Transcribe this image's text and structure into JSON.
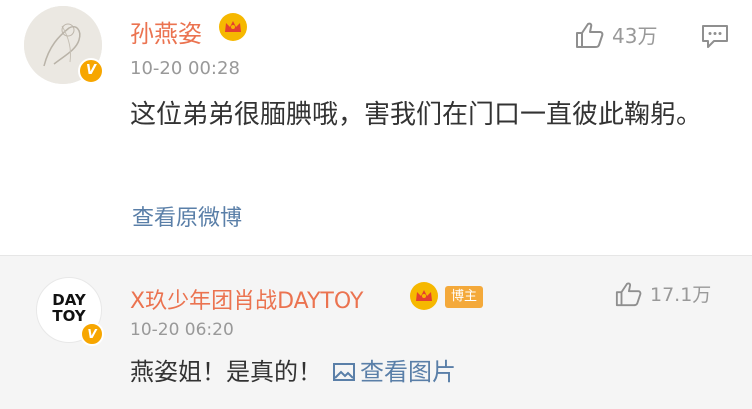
{
  "comments": [
    {
      "username": "孙燕姿",
      "time": "10-20 00:28",
      "text": "这位弟弟很腼腆哦，害我们在门口一直彼此鞠躬。",
      "likes": "43万",
      "view_original": "查看原微博",
      "verified_icon": "verified-v-icon",
      "crown_icon": "crown-icon"
    },
    {
      "username": "X玖少年团肖战DAYTOY",
      "badge": "博主",
      "time": "10-20 06:20",
      "text": "燕姿姐！是真的！",
      "view_pic": "查看图片",
      "likes": "17.1万",
      "avatar_text_line1": "DAY",
      "avatar_text_line2": "TOY"
    }
  ],
  "colors": {
    "username": "#eb7350",
    "link": "#5a7fa8",
    "muted": "#999999",
    "text": "#333333",
    "reply_bg": "#f5f5f5",
    "verified_badge": "#f7a600"
  }
}
